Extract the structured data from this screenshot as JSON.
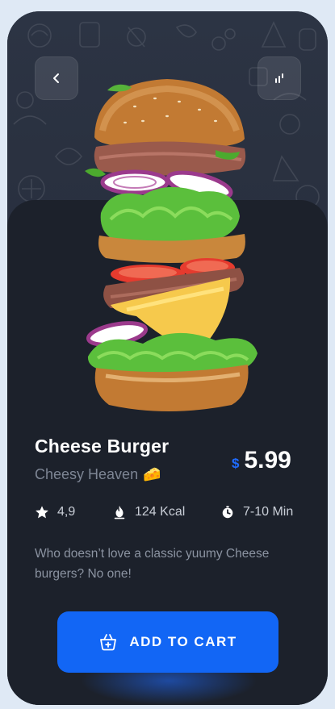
{
  "header": {
    "back_icon": "chevron-left-icon",
    "stats_icon": "bar-chart-icon"
  },
  "product": {
    "name": "Cheese Burger",
    "tagline": "Cheesy Heaven",
    "tagline_emoji": "🧀",
    "currency": "$",
    "price": "5.99",
    "rating": "4,9",
    "calories": "124 Kcal",
    "time": "7-10 Min",
    "description": "Who doesn’t love a classic yuumy Cheese burgers? No one!"
  },
  "actions": {
    "add_to_cart_label": "ADD TO CART",
    "add_to_cart_icon": "basket-plus-icon"
  },
  "colors": {
    "background": "#1c212b",
    "accent": "#1266f5",
    "price_currency": "#1f6bff"
  }
}
